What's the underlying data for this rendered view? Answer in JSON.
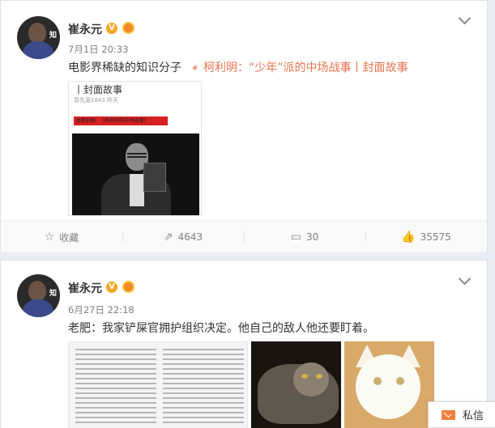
{
  "posts": [
    {
      "author": "崔永元",
      "time": "7月1日 20:33",
      "text": "电影界稀缺的知识分子",
      "link_text": "柯利明：“少年”派的中场战事丨封面故事",
      "article": {
        "title": "丨封面故事",
        "meta": "郭先源1843  昨天",
        "banner": "本期封面 · 《柯利明的中场战事》"
      },
      "actions": {
        "favorite": "收藏",
        "repost": "4643",
        "comment": "30",
        "like": "35575"
      }
    },
    {
      "author": "崔永元",
      "time": "6月27日 22:18",
      "text": "老肥：我家铲屎官拥护组织决定。他自己的敌人他还要盯着。"
    }
  ],
  "vip_badge": "V",
  "private_message": {
    "label": "私信"
  },
  "colors": {
    "link": "#eb7350",
    "badge": "#f5a623",
    "page_bg": "#e9ecf0"
  }
}
